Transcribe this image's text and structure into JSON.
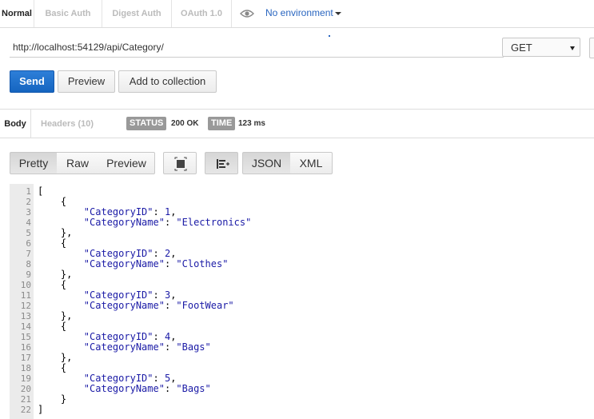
{
  "auth_tabs": [
    {
      "label": "Normal",
      "active": true
    },
    {
      "label": "Basic Auth",
      "active": false
    },
    {
      "label": "Digest Auth",
      "active": false
    },
    {
      "label": "OAuth 1.0",
      "active": false
    }
  ],
  "environment": {
    "label": "No environment",
    "icon": "eye-icon"
  },
  "request": {
    "url": "http://localhost:54129/api/Category/",
    "method": "GET"
  },
  "actions": {
    "send": "Send",
    "preview": "Preview",
    "add_to_collection": "Add to collection"
  },
  "response_tabs": {
    "body": "Body",
    "headers": "Headers (10)"
  },
  "status": {
    "status_label": "STATUS",
    "status_value": "200 OK",
    "time_label": "TIME",
    "time_value": "123 ms"
  },
  "view_modes": {
    "pretty": "Pretty",
    "raw": "Raw",
    "preview": "Preview",
    "json": "JSON",
    "xml": "XML"
  },
  "response_body": [
    {
      "id": 1,
      "name": "Electronics"
    },
    {
      "id": 2,
      "name": "Clothes"
    },
    {
      "id": 3,
      "name": "FootWear"
    },
    {
      "id": 4,
      "name": "Bags"
    },
    {
      "id": 5,
      "name": "Bags"
    }
  ],
  "colors": {
    "accent": "#1a6ccf",
    "json_key": "#1a1aa6",
    "status_badge": "#999999"
  }
}
